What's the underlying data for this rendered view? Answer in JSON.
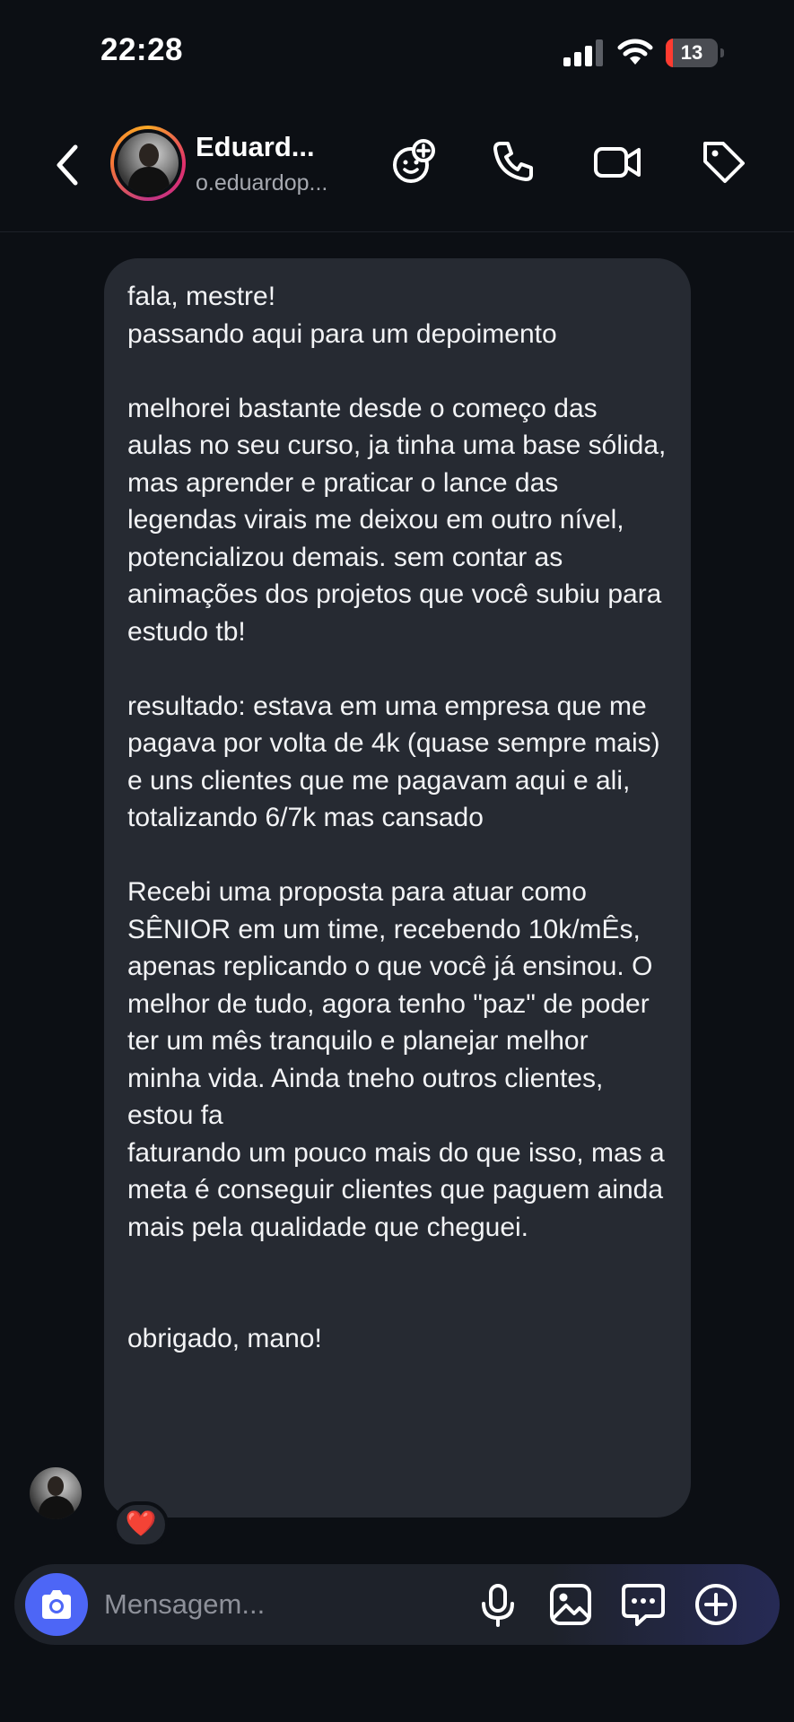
{
  "status_bar": {
    "time": "22:28",
    "battery_level": "13",
    "battery_percent": 13,
    "icons": [
      "cellular-signal-icon",
      "wifi-icon",
      "battery-icon"
    ]
  },
  "header": {
    "contact_name": "Eduard...",
    "contact_username": "o.eduardop...",
    "icons": [
      "back-chevron-icon",
      "add-people-icon",
      "phone-icon",
      "video-camera-icon",
      "tag-icon"
    ]
  },
  "message": {
    "text": "fala, mestre!\npassando aqui para um depoimento\n\nmelhorei bastante desde o começo das aulas no seu curso, ja tinha uma base sólida, mas aprender e praticar o lance das legendas virais me deixou em outro nível, potencializou demais. sem contar as animações dos projetos que você subiu para estudo tb!\n\nresultado: estava em uma empresa que me pagava por volta de 4k (quase sempre mais) e uns clientes que me pagavam aqui e ali, totalizando 6/7k mas cansado\n\nRecebi uma proposta para atuar como SÊNIOR em um time, recebendo 10k/mÊs, apenas replicando o que você já ensinou. O melhor de tudo, agora tenho \"paz\" de poder ter um mês tranquilo e planejar melhor minha vida. Ainda tneho outros clientes, estou fa\nfaturando um pouco mais do que isso, mas a meta é conseguir clientes que paguem ainda mais pela qualidade que cheguei.\n\n\nobrigado, mano!",
    "reaction": "❤️"
  },
  "composer": {
    "placeholder": "Mensagem...",
    "value": "",
    "icons": [
      "camera-icon",
      "microphone-icon",
      "gallery-icon",
      "sticker-chat-icon",
      "plus-circle-icon"
    ]
  },
  "colors": {
    "background": "#0c0f14",
    "bubble": "#262a32",
    "camera_button": "#4d66f6",
    "battery_low": "#ff3b30",
    "reaction_heart": "#ff2d3f"
  }
}
